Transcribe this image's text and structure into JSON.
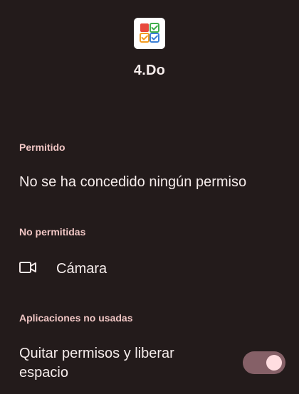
{
  "app": {
    "name": "4.Do",
    "icon": "checklist-app-icon"
  },
  "sections": {
    "allowed": {
      "title": "Permitido",
      "empty_text": "No se ha concedido ningún permiso"
    },
    "not_allowed": {
      "title": "No permitidas",
      "items": [
        {
          "label": "Cámara",
          "icon": "camera-icon"
        }
      ]
    },
    "unused_apps": {
      "title": "Aplicaciones no usadas",
      "setting_line1": "Quitar permisos y liberar",
      "setting_line2": "espacio",
      "toggle_on": true
    }
  },
  "colors": {
    "background": "#231b1b",
    "section_title": "#f0c6c4",
    "text": "#f5eceb",
    "toggle_track": "#856067",
    "toggle_knob": "#ffdde0"
  }
}
